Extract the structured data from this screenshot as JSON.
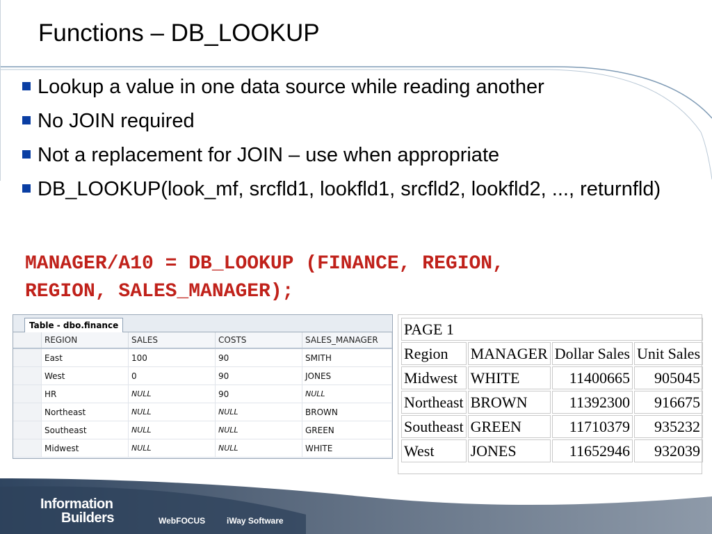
{
  "slide": {
    "title": "Functions – DB_LOOKUP",
    "bullets": [
      "Lookup a value in one data source while reading another",
      "No JOIN required",
      "Not a replacement for JOIN – use when appropriate",
      "DB_LOOKUP(look_mf, srcfld1, lookfld1, srcfld2, lookfld2, ..., returnfld)"
    ],
    "code": "MANAGER/A10 = DB_LOOKUP (FINANCE, REGION,\nREGION, SALES_MANAGER);"
  },
  "sql_grid": {
    "tab_label": "Table - dbo.finance",
    "columns": [
      "REGION",
      "SALES",
      "COSTS",
      "SALES_MANAGER"
    ],
    "rows": [
      [
        "East",
        "100",
        "90",
        "SMITH"
      ],
      [
        "West",
        "0",
        "90",
        "JONES"
      ],
      [
        "HR",
        "NULL",
        "90",
        "NULL"
      ],
      [
        "Northeast",
        "NULL",
        "NULL",
        "BROWN"
      ],
      [
        "Southeast",
        "NULL",
        "NULL",
        "GREEN"
      ],
      [
        "Midwest",
        "NULL",
        "NULL",
        "WHITE"
      ]
    ]
  },
  "report": {
    "page_label": "PAGE 1",
    "columns": [
      "Region",
      "MANAGER",
      "Dollar Sales",
      "Unit Sales"
    ],
    "rows": [
      [
        "Midwest",
        "WHITE",
        "11400665",
        "905045"
      ],
      [
        "Northeast",
        "BROWN",
        "11392300",
        "916675"
      ],
      [
        "Southeast",
        "GREEN",
        "11710379",
        "935232"
      ],
      [
        "West",
        "JONES",
        "11652946",
        "932039"
      ]
    ]
  },
  "footer": {
    "brand_line1": "Information",
    "brand_line2": "Builders",
    "links": [
      "WebFOCUS",
      "iWay Software"
    ]
  },
  "colors": {
    "bullet": "#0a3ea3",
    "code": "#c0211a",
    "footer_dark": "#3f4f63",
    "footer_light": "#8a97a8",
    "swoosh": "#7f9bb5"
  }
}
